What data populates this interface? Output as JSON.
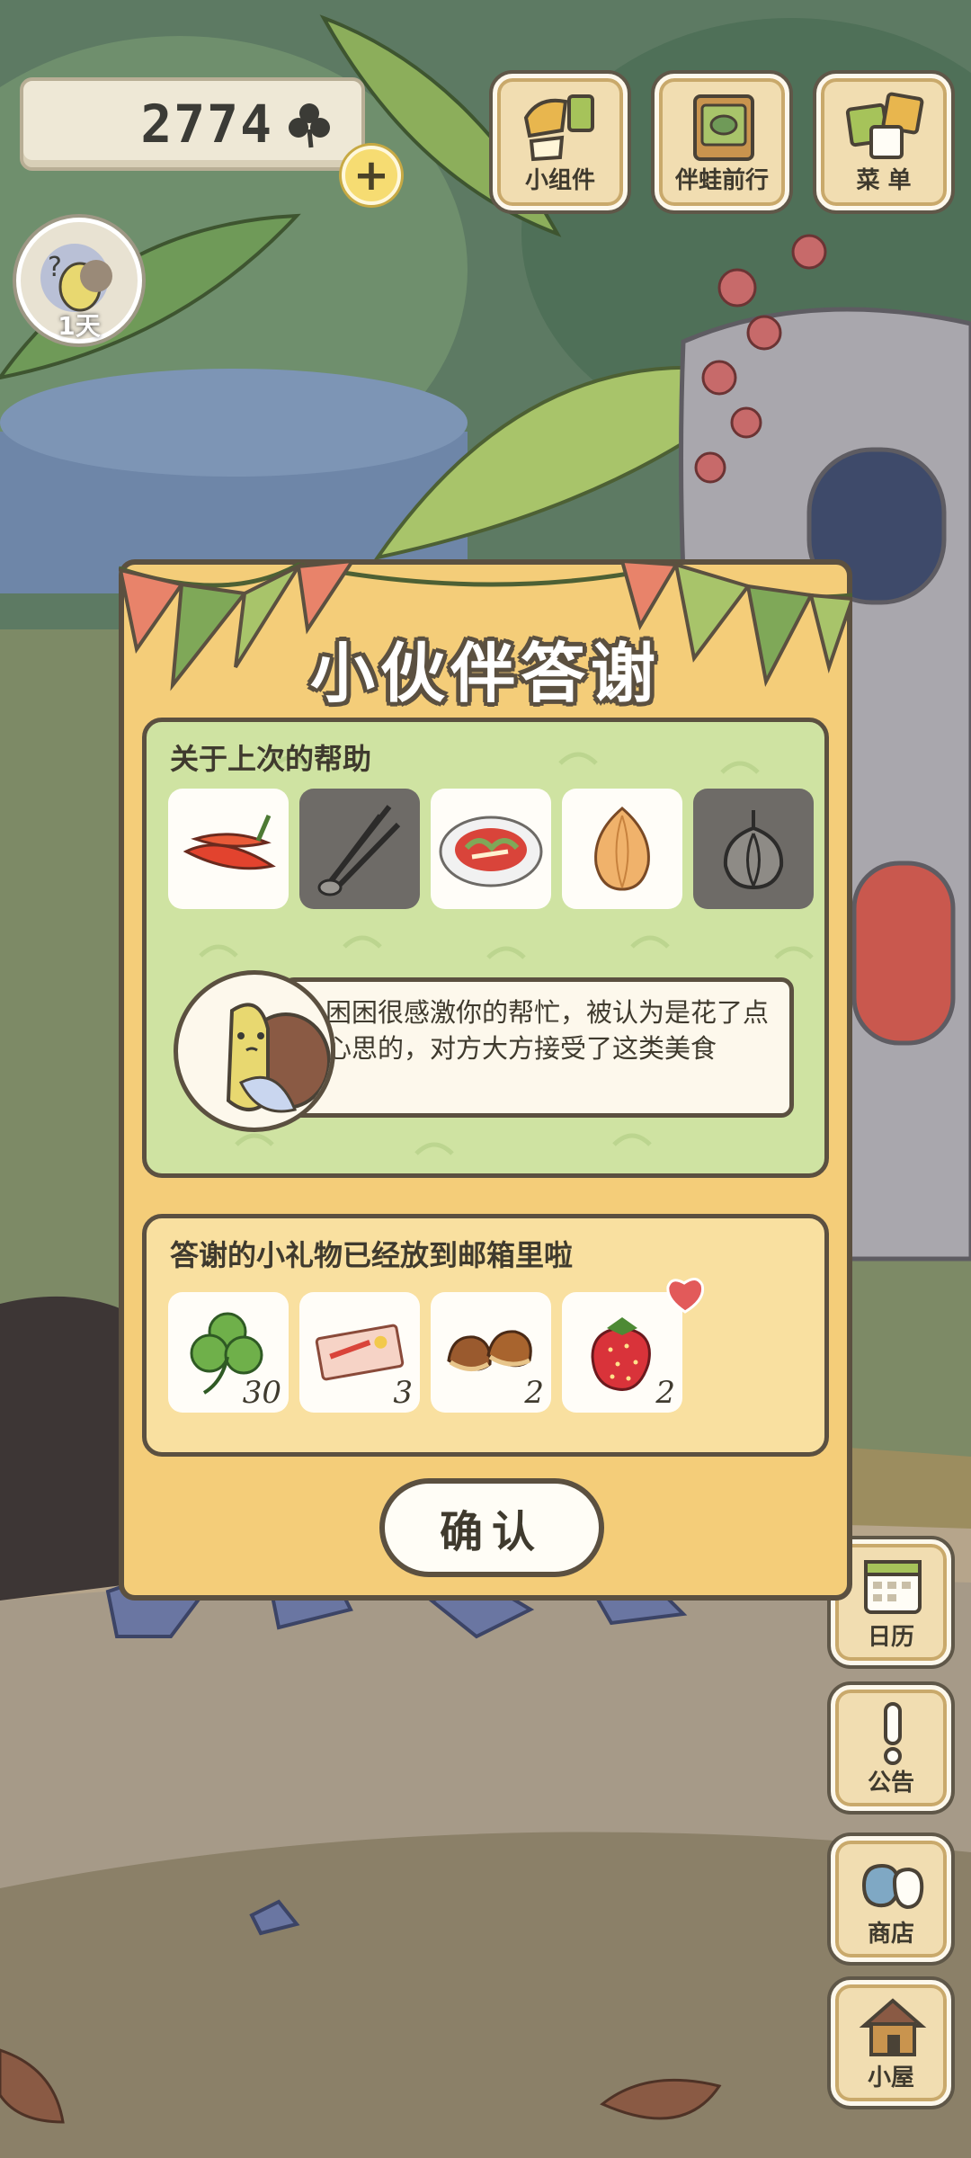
{
  "header": {
    "clover_count": "2774",
    "days_label": "1天",
    "buttons": [
      {
        "label": "小组件",
        "icon": "widget-icon"
      },
      {
        "label": "伴蛙前行",
        "icon": "journey-book-icon"
      },
      {
        "label": "菜 单",
        "icon": "menu-cards-icon"
      }
    ]
  },
  "side_buttons": [
    {
      "label": "日历",
      "icon": "calendar-icon"
    },
    {
      "label": "公告",
      "icon": "exclamation-icon"
    },
    {
      "label": "商店",
      "icon": "shop-bags-icon"
    },
    {
      "label": "小屋",
      "icon": "house-icon"
    }
  ],
  "dialog": {
    "title": "小伙伴答谢",
    "help_section": {
      "title": "关于上次的帮助",
      "items": [
        {
          "name": "chili-pepper",
          "dimmed": false
        },
        {
          "name": "green-onion",
          "dimmed": true
        },
        {
          "name": "cold-dish-plate",
          "dimmed": false
        },
        {
          "name": "onion",
          "dimmed": false
        },
        {
          "name": "garlic",
          "dimmed": true
        }
      ],
      "message": "困困很感激你的帮忙，被认为是花了点心思的，对方大方接受了这类美食"
    },
    "gift_section": {
      "title": "答谢的小礼物已经放到邮箱里啦",
      "items": [
        {
          "name": "clover",
          "qty": "30"
        },
        {
          "name": "ticket",
          "qty": "3"
        },
        {
          "name": "chestnuts",
          "qty": "2"
        },
        {
          "name": "strawberry",
          "qty": "2"
        }
      ]
    },
    "confirm_label": "确认"
  },
  "colors": {
    "dialog_bg": "#f4cd79",
    "help_bg": "#cfe3a2",
    "gift_bg": "#f9e0a0",
    "outline": "#5b5040"
  }
}
